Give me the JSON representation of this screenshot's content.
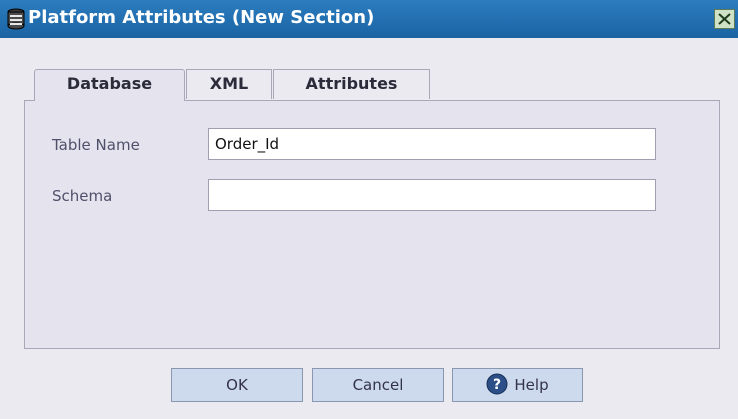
{
  "window": {
    "title": "Platform Attributes (New Section)",
    "icon": "database-icon",
    "close_icon": "close-icon"
  },
  "tabs": [
    {
      "label": "Database",
      "active": true
    },
    {
      "label": "XML",
      "active": false
    },
    {
      "label": "Attributes",
      "active": false
    }
  ],
  "form": {
    "table_name_label": "Table Name",
    "table_name_value": "Order_Id",
    "schema_label": "Schema",
    "schema_value": ""
  },
  "buttons": {
    "ok": "OK",
    "cancel": "Cancel",
    "help": "Help",
    "help_icon": "help-circle-icon"
  },
  "colors": {
    "titlebar": "#226fb0",
    "dialog_bg": "#ebeaf1",
    "button_bg": "#cdd9ec"
  }
}
